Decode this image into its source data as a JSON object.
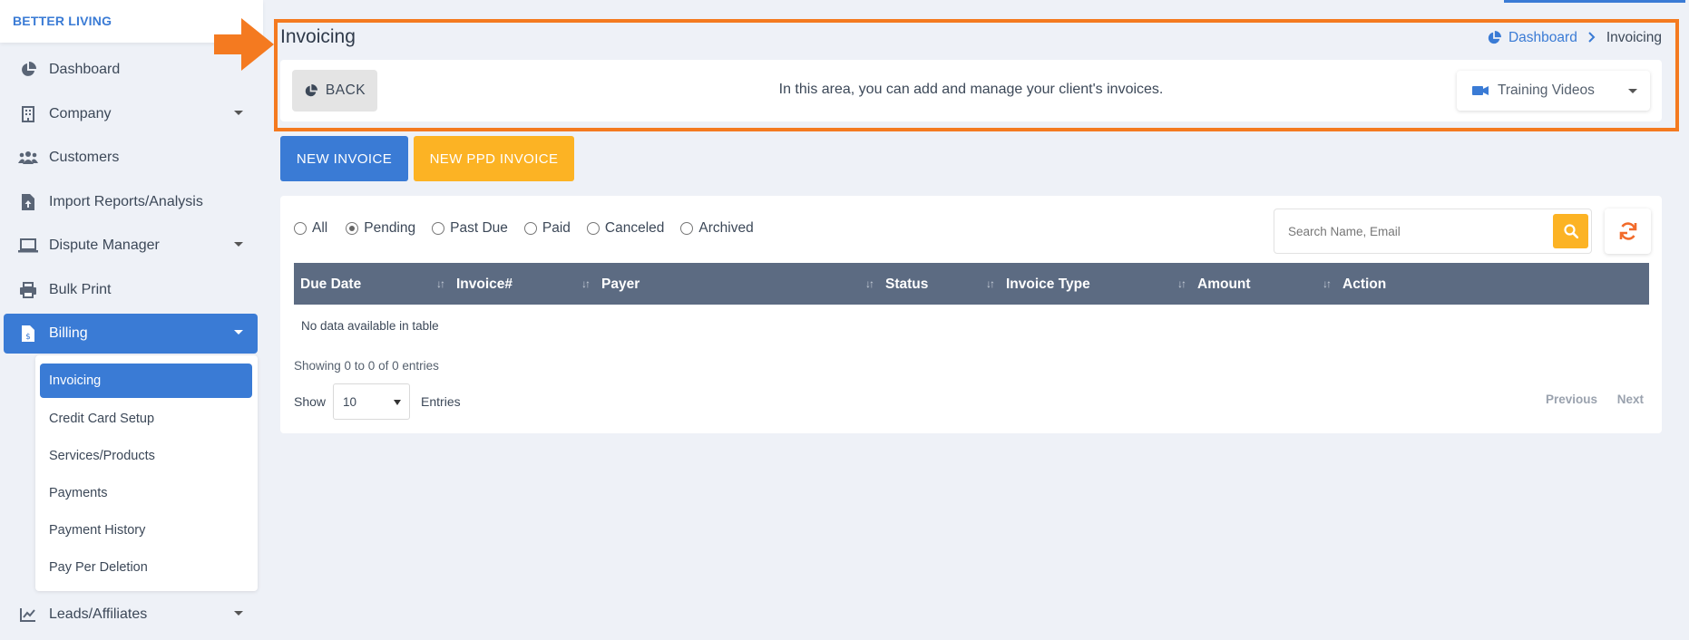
{
  "brand": "BETTER LIVING",
  "sidebar": {
    "items": [
      {
        "label": "Dashboard",
        "icon": "chart-pie-icon"
      },
      {
        "label": "Company",
        "icon": "building-icon"
      },
      {
        "label": "Customers",
        "icon": "users-icon"
      },
      {
        "label": "Import Reports/Analysis",
        "icon": "file-upload-icon"
      },
      {
        "label": "Dispute Manager",
        "icon": "laptop-icon"
      },
      {
        "label": "Bulk Print",
        "icon": "printer-icon"
      },
      {
        "label": "Billing",
        "icon": "invoice-dollar-icon"
      },
      {
        "label": "Leads/Affiliates",
        "icon": "chart-line-icon"
      }
    ],
    "billing_submenu": [
      "Invoicing",
      "Credit Card Setup",
      "Services/Products",
      "Payments",
      "Payment History",
      "Pay Per Deletion"
    ]
  },
  "header": {
    "title": "Invoicing",
    "breadcrumb": {
      "home": "Dashboard",
      "current": "Invoicing"
    },
    "back_label": "BACK",
    "info_text": "In this area, you can add and manage your client's invoices.",
    "training_label": "Training Videos"
  },
  "actions": {
    "new_invoice": "NEW INVOICE",
    "new_ppd_invoice": "NEW PPD INVOICE"
  },
  "filters": {
    "options": [
      "All",
      "Pending",
      "Past Due",
      "Paid",
      "Canceled",
      "Archived"
    ],
    "selected": "Pending"
  },
  "search": {
    "placeholder": "Search Name, Email"
  },
  "table": {
    "columns": [
      "Due Date",
      "Invoice#",
      "Payer",
      "Status",
      "Invoice Type",
      "Amount",
      "Action"
    ],
    "empty_text": "No data available in table",
    "showing_text": "Showing 0 to 0 of 0 entries",
    "show_label": "Show",
    "page_size": "10",
    "entries_label": "Entries",
    "previous": "Previous",
    "next": "Next"
  },
  "colors": {
    "primary": "#3a7bd5",
    "warning": "#fcb324",
    "highlight": "#f47a20",
    "table_header": "#5c6b82"
  }
}
